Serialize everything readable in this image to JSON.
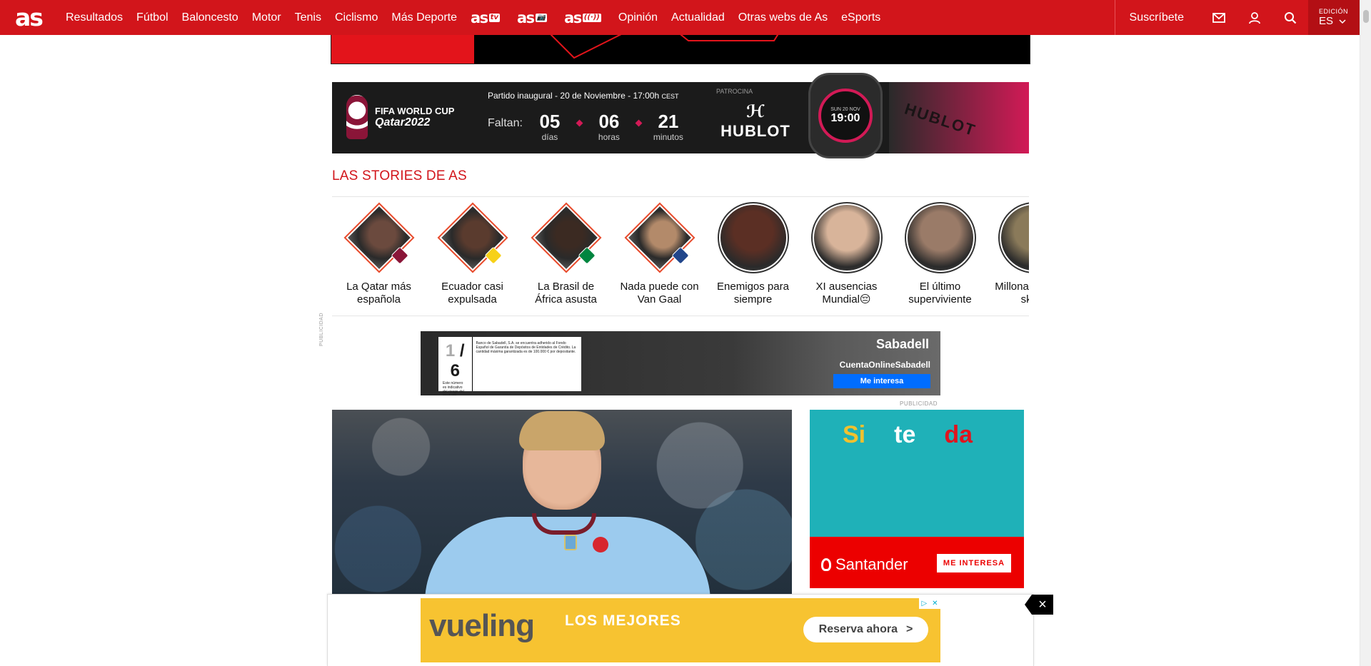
{
  "header": {
    "logo": "as",
    "nav": [
      "Resultados",
      "Fútbol",
      "Baloncesto",
      "Motor",
      "Tenis",
      "Ciclismo",
      "Más Deporte"
    ],
    "brands": [
      {
        "name": "as",
        "tag": "tv"
      },
      {
        "name": "as",
        "tag": "📷"
      },
      {
        "name": "as",
        "tag": "((·))"
      }
    ],
    "nav_after": [
      "Opinión",
      "Actualidad",
      "Otras webs de As",
      "eSports"
    ],
    "subscribe": "Suscríbete",
    "edition_label": "EDICIÓN",
    "edition_value": "ES",
    "icons": [
      "mail-icon",
      "user-icon",
      "search-icon"
    ]
  },
  "worldcup": {
    "logo_line1": "FIFA WORLD CUP",
    "logo_line2": "Qatar2022",
    "match": "Partido inaugural - 20 de Noviembre - 17:00h",
    "match_tz": "CEST",
    "faltan": "Faltan:",
    "days": "05",
    "days_label": "días",
    "hours": "06",
    "hours_label": "horas",
    "minutes": "21",
    "minutes_label": "minutos",
    "sponsor_label": "PATROCINA",
    "sponsor": "HUBLOT",
    "watch_date": "SUN 20 NOV",
    "watch_time": "19:00",
    "strap_text": "HUBLOT"
  },
  "stories": {
    "title": "LAS STORIES DE AS",
    "items": [
      {
        "caption": "La Qatar más española",
        "shape": "diamond",
        "color": "#6b4a3e",
        "flag": "#8a1538"
      },
      {
        "caption": "Ecuador casi expulsada",
        "shape": "diamond",
        "color": "#5a3b2e",
        "flag": "#f7d117"
      },
      {
        "caption": "La Brasil de África asusta",
        "shape": "diamond",
        "color": "#3b2a22",
        "flag": "#00853f"
      },
      {
        "caption": "Nada puede con Van Gaal",
        "shape": "diamond",
        "color": "#b38a6a",
        "flag": "#21468b"
      },
      {
        "caption": "Enemigos para siempre",
        "shape": "circle",
        "color": "#5b2f24"
      },
      {
        "caption": "XI ausencias Mundial😔",
        "shape": "circle",
        "color": "#d8b49a"
      },
      {
        "caption": "El último superviviente",
        "shape": "circle",
        "color": "#9a7b68"
      },
      {
        "caption": "Millonarios en el skate",
        "shape": "circle",
        "color": "#8a7a5a"
      }
    ]
  },
  "ads": {
    "publicidad_vertical": "PUBLICIDAD",
    "publicidad": "PUBLICIDAD",
    "sabadell": {
      "ratio_left": "1",
      "ratio_right": "6",
      "risk_text": "Este número es indicativo del riesgo del producto, siendo 1/6 indicativo de menor riesgo y 6/6 de mayor riesgo.",
      "fund_text": "Banco de Sabadell, S.A. se encuentra adherido al Fondo Español de Garantía de Depósitos de Entidades de Crédito. La cantidad máxima garantizada es de 100.000 € por depositante.",
      "brand": "Sabadell",
      "product": "CuentaOnlineSabadell",
      "cta": "Me interesa"
    },
    "santander": {
      "word1": "Si",
      "word2": "te",
      "word3": "da",
      "brand": "Santander",
      "cta": "ME INTERESA"
    },
    "vueling": {
      "brand": "vueling",
      "headline": "LOS MEJORES",
      "cta": "Reserva ahora",
      "cta_arrow": ">"
    }
  },
  "colors": {
    "brand_red": "#d2151b",
    "stories_accent": "#e84a2b",
    "qatar_maroon": "#8a1538",
    "hublot_pink": "#d21a56"
  }
}
